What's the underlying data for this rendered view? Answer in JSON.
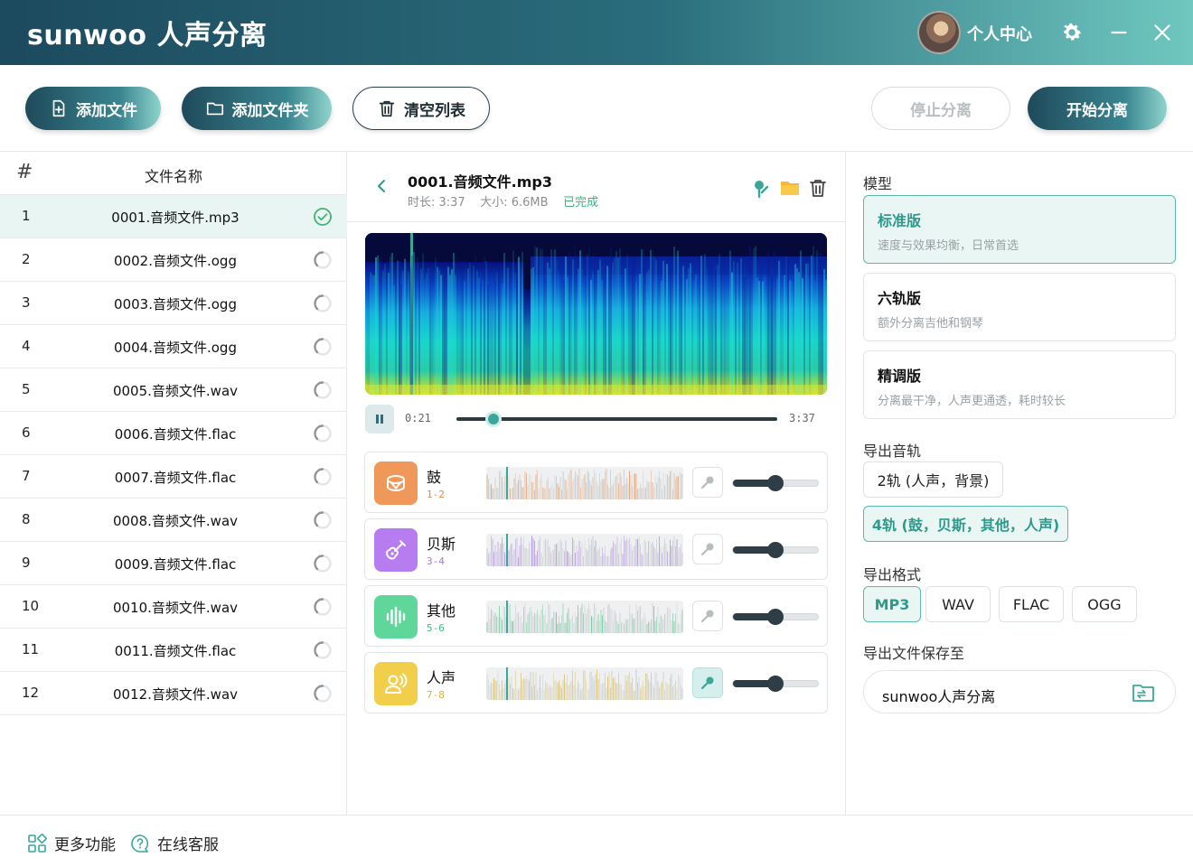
{
  "app": {
    "title": "sunwoo 人声分离"
  },
  "titlebar": {
    "user_center": "个人中心"
  },
  "toolbar": {
    "add_file": "添加文件",
    "add_folder": "添加文件夹",
    "clear_list": "清空列表",
    "stop": "停止分离",
    "start": "开始分离"
  },
  "file_list": {
    "col_index": "#",
    "col_name": "文件名称",
    "rows": [
      {
        "index": "1",
        "name": "0001.音频文件.mp3",
        "status": "done"
      },
      {
        "index": "2",
        "name": "0002.音频文件.ogg",
        "status": "pending"
      },
      {
        "index": "3",
        "name": "0003.音频文件.ogg",
        "status": "pending"
      },
      {
        "index": "4",
        "name": "0004.音频文件.ogg",
        "status": "pending"
      },
      {
        "index": "5",
        "name": "0005.音频文件.wav",
        "status": "pending"
      },
      {
        "index": "6",
        "name": "0006.音频文件.flac",
        "status": "pending"
      },
      {
        "index": "7",
        "name": "0007.音频文件.flac",
        "status": "pending"
      },
      {
        "index": "8",
        "name": "0008.音频文件.wav",
        "status": "pending"
      },
      {
        "index": "9",
        "name": "0009.音频文件.flac",
        "status": "pending"
      },
      {
        "index": "10",
        "name": "0010.音频文件.wav",
        "status": "pending"
      },
      {
        "index": "11",
        "name": "0011.音频文件.flac",
        "status": "pending"
      },
      {
        "index": "12",
        "name": "0012.音频文件.wav",
        "status": "pending"
      }
    ]
  },
  "detail": {
    "file_name": "0001.音频文件.mp3",
    "duration_label": "时长: 3:37",
    "size_label": "大小: 6.6MB",
    "status_label": "已完成",
    "player": {
      "current": "0:21",
      "total": "3:37",
      "progress": 0.115
    },
    "tracks": [
      {
        "name": "鼓",
        "channels": "1-2",
        "color": "#f0975a",
        "accent": "#e58a4a",
        "icon": "drum-icon",
        "volume": 0.5,
        "solo": false
      },
      {
        "name": "贝斯",
        "channels": "3-4",
        "color": "#b67cf0",
        "accent": "#a67ad8",
        "icon": "guitar-icon",
        "volume": 0.5,
        "solo": false
      },
      {
        "name": "其他",
        "channels": "5-6",
        "color": "#5fd69a",
        "accent": "#3fbf7f",
        "icon": "soundwave-icon",
        "volume": 0.5,
        "solo": false
      },
      {
        "name": "人声",
        "channels": "7-8",
        "color": "#f2cf4a",
        "accent": "#d8b43a",
        "icon": "singer-icon",
        "volume": 0.5,
        "solo": true
      }
    ]
  },
  "settings": {
    "model_label": "模型",
    "models": [
      {
        "name": "标准版",
        "desc": "速度与效果均衡，日常首选",
        "active": true
      },
      {
        "name": "六轨版",
        "desc": "额外分离吉他和钢琴",
        "active": false
      },
      {
        "name": "精调版",
        "desc": "分离最干净，人声更通透，耗时较长",
        "active": false
      }
    ],
    "export_track_label": "导出音轨",
    "track_options": [
      {
        "label": "2轨 (人声，背景)",
        "active": false
      },
      {
        "label": "4轨 (鼓，贝斯，其他，人声)",
        "active": true
      }
    ],
    "export_format_label": "导出格式",
    "formats": [
      {
        "label": "MP3",
        "active": true
      },
      {
        "label": "WAV",
        "active": false
      },
      {
        "label": "FLAC",
        "active": false
      },
      {
        "label": "OGG",
        "active": false
      }
    ],
    "save_to_label": "导出文件保存至",
    "save_path": "sunwoo人声分离"
  },
  "footer": {
    "more": "更多功能",
    "support": "在线客服"
  },
  "colors": {
    "accent": "#3aa79a",
    "dark": "#1f4a5b",
    "done": "#3fb37a"
  }
}
